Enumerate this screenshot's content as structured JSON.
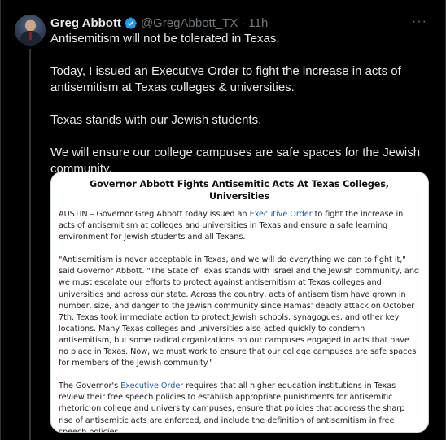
{
  "author": {
    "name": "Greg Abbott",
    "handle": "@GregAbbott_TX",
    "separator": "·",
    "time": "11h",
    "verified": true,
    "verified_color": "#1d9bf0",
    "avatar_icon": "profile-photo"
  },
  "more_label": "···",
  "tweet": {
    "lines": [
      "Antisemitism will not be tolerated in Texas.",
      "Today, I issued an Executive Order to fight the increase in acts of antisemitism at Texas colleges & universities.",
      "Texas stands with our Jewish students.",
      "We will ensure our college campuses are safe spaces for the Jewish community."
    ]
  },
  "card": {
    "title": "Governor Abbott Fights Antisemitic Acts At Texas Colleges, Universities",
    "p1_before": "AUSTIN – Governor Greg Abbott today issued an ",
    "p1_link": "Executive Order",
    "p1_after": " to fight the increase in acts of antisemitism at colleges and universities in Texas and ensure a safe learning environment for Jewish students and all Texans.",
    "p2": "\"Antisemitism is never acceptable in Texas, and we will do everything we can to fight it,\" said Governor Abbott. \"The State of Texas stands with Israel and the Jewish community, and we must escalate our efforts to protect against antisemitism at Texas colleges and universities and across our state. Across the country, acts of antisemitism have grown in number, size, and danger to the Jewish community since Hamas' deadly attack on October 7th. Texas took immediate action to protect Jewish schools, synagogues, and other key locations. Many Texas colleges and universities also acted quickly to condemn antisemitism, but some radical organizations on our campuses engaged in acts that have no place in Texas. Now, we must work to ensure that our college campuses are safe spaces for members of the Jewish community.\"",
    "p3_before": "The Governor's ",
    "p3_link": "Executive Order",
    "p3_after": " requires that all higher education institutions in Texas review their free speech policies to establish appropriate punishments for antisemitic rhetoric on college and university campuses, ensure that policies that address the sharp rise of antisemitic acts are enforced, and include the definition of antisemitism in free speech policies.",
    "link_color": "#1f5fb4"
  }
}
